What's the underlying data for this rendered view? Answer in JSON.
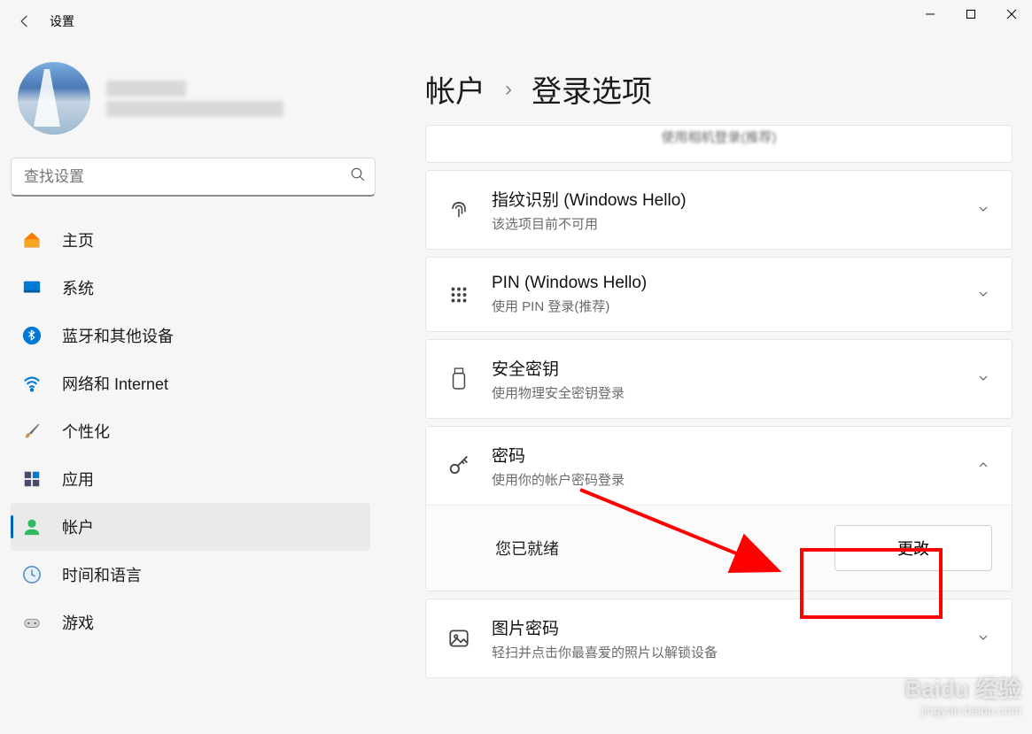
{
  "app": {
    "title": "设置"
  },
  "search": {
    "placeholder": "查找设置"
  },
  "nav": {
    "items": [
      {
        "label": "主页"
      },
      {
        "label": "系统"
      },
      {
        "label": "蓝牙和其他设备"
      },
      {
        "label": "网络和 Internet"
      },
      {
        "label": "个性化"
      },
      {
        "label": "应用"
      },
      {
        "label": "帐户"
      },
      {
        "label": "时间和语言"
      },
      {
        "label": "游戏"
      }
    ]
  },
  "breadcrumb": {
    "parent": "帐户",
    "current": "登录选项"
  },
  "options": {
    "camera_partial": "使用相机登录(推荐)",
    "fingerprint": {
      "title": "指纹识别 (Windows Hello)",
      "sub": "该选项目前不可用"
    },
    "pin": {
      "title": "PIN (Windows Hello)",
      "sub": "使用 PIN 登录(推荐)"
    },
    "seckey": {
      "title": "安全密钥",
      "sub": "使用物理安全密钥登录"
    },
    "password": {
      "title": "密码",
      "sub": "使用你的帐户密码登录",
      "status": "您已就绪",
      "change_btn": "更改"
    },
    "picture": {
      "title": "图片密码",
      "sub": "轻扫并点击你最喜爱的照片以解锁设备"
    }
  },
  "watermark": {
    "main": "Baidu 经验",
    "sub": "jingyan.baidu.com"
  }
}
